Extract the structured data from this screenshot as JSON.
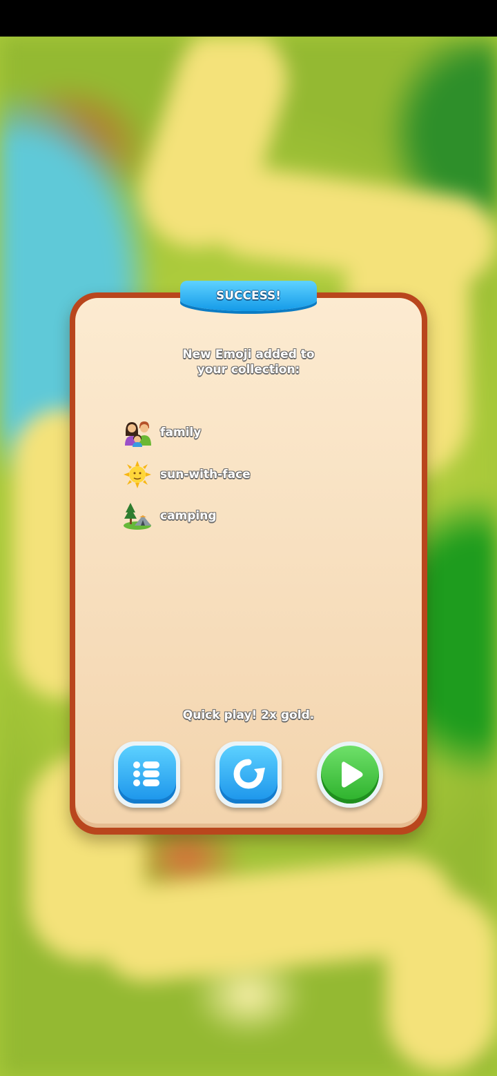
{
  "popup": {
    "banner_title": "SUCCESS!",
    "headline_line1": "New Emoji added to",
    "headline_line2": "your collection:",
    "emojis": [
      {
        "icon": "family-emoji-icon",
        "label": "family"
      },
      {
        "icon": "sun-with-face-emoji-icon",
        "label": "sun-with-face"
      },
      {
        "icon": "camping-emoji-icon",
        "label": "camping"
      }
    ],
    "quick_play_text": "Quick play! 2x gold.",
    "buttons": [
      {
        "name": "level-list-button",
        "icon": "list-icon"
      },
      {
        "name": "replay-button",
        "icon": "replay-icon"
      },
      {
        "name": "play-next-button",
        "icon": "play-icon"
      }
    ]
  },
  "colors": {
    "banner": "#1a9ee8",
    "popup_border": "#b9461d",
    "popup_fill": "#f8e2c2",
    "blue_button": "#1a93ea",
    "green_button": "#2bb02a"
  }
}
